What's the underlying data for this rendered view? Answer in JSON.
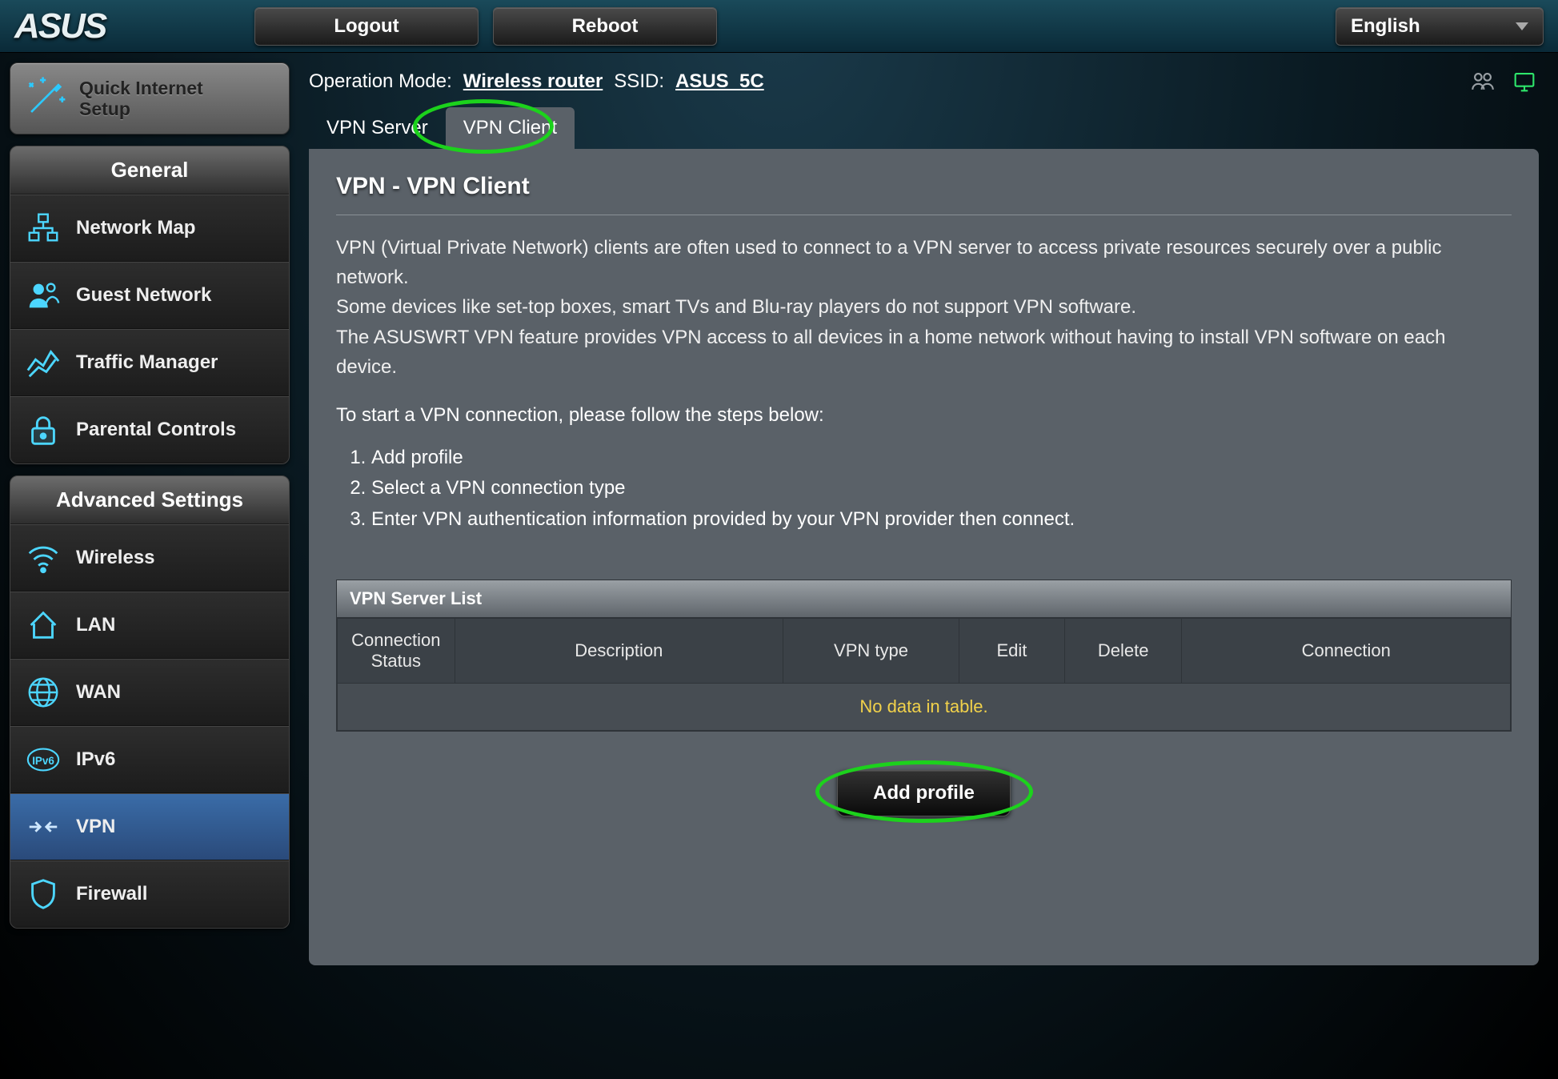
{
  "topbar": {
    "logo": "ASUS",
    "logout": "Logout",
    "reboot": "Reboot",
    "language": "English"
  },
  "quick_setup": {
    "line1": "Quick Internet",
    "line2": "Setup"
  },
  "sidebar": {
    "general_title": "General",
    "general_items": [
      {
        "id": "network-map",
        "label": "Network Map"
      },
      {
        "id": "guest-network",
        "label": "Guest Network"
      },
      {
        "id": "traffic-manager",
        "label": "Traffic Manager"
      },
      {
        "id": "parental-controls",
        "label": "Parental Controls"
      }
    ],
    "advanced_title": "Advanced Settings",
    "advanced_items": [
      {
        "id": "wireless",
        "label": "Wireless"
      },
      {
        "id": "lan",
        "label": "LAN"
      },
      {
        "id": "wan",
        "label": "WAN"
      },
      {
        "id": "ipv6",
        "label": "IPv6"
      },
      {
        "id": "vpn",
        "label": "VPN"
      },
      {
        "id": "firewall",
        "label": "Firewall"
      }
    ]
  },
  "status": {
    "mode_label": "Operation Mode:",
    "mode_value": "Wireless router",
    "ssid_label": "SSID:",
    "ssid_value": "ASUS_5C"
  },
  "tabs": {
    "server": "VPN Server",
    "client": "VPN Client"
  },
  "content": {
    "heading": "VPN - VPN Client",
    "p1": "VPN (Virtual Private Network) clients are often used to connect to a VPN server to access private resources securely over a public network.",
    "p2": "Some devices like set-top boxes, smart TVs and Blu-ray players do not support VPN software.",
    "p3": "The ASUSWRT VPN feature provides VPN access to all devices in a home network without having to install VPN software on each device.",
    "steps_intro": "To start a VPN connection, please follow the steps below:",
    "steps": [
      "Add profile",
      "Select a VPN connection type",
      "Enter VPN authentication information provided by your VPN provider then connect."
    ],
    "list_title": "VPN Server List",
    "columns": [
      "Connection Status",
      "Description",
      "VPN type",
      "Edit",
      "Delete",
      "Connection"
    ],
    "empty": "No data in table.",
    "add_profile": "Add profile"
  }
}
